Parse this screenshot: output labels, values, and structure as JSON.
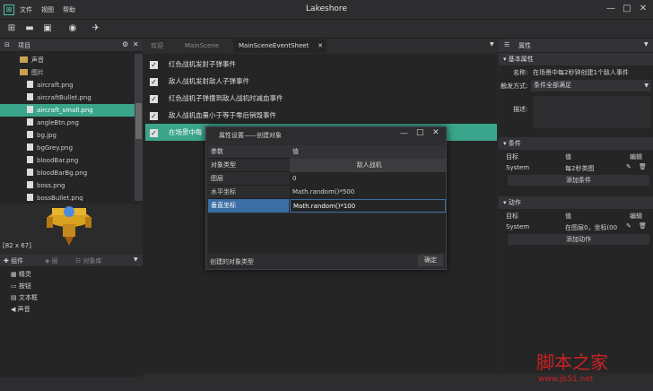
{
  "app": {
    "title": "Lakeshore",
    "menu": [
      "文件",
      "视图",
      "帮助"
    ]
  },
  "left": {
    "project_label": "项目",
    "tree": [
      {
        "label": "声音",
        "type": "folder"
      },
      {
        "label": "图片",
        "type": "folder"
      },
      {
        "label": "aircraft.png",
        "type": "file"
      },
      {
        "label": "aircraftBullet.png",
        "type": "file"
      },
      {
        "label": "aircraft_small.png",
        "type": "file",
        "selected": true
      },
      {
        "label": "angleBtn.png",
        "type": "file"
      },
      {
        "label": "bg.jpg",
        "type": "file"
      },
      {
        "label": "bgGrey.png",
        "type": "file"
      },
      {
        "label": "bloodBar.png",
        "type": "file"
      },
      {
        "label": "bloodBarBg.png",
        "type": "file"
      },
      {
        "label": "boss.png",
        "type": "file"
      },
      {
        "label": "bossBullet.png",
        "type": "file"
      }
    ],
    "preview_size": "[82 x 67]",
    "comp_tabs": [
      "组件",
      "层",
      "对象库"
    ],
    "components": [
      "精灵",
      "按钮",
      "文本框",
      "声音"
    ]
  },
  "tabs": [
    "欢迎",
    "MainScene",
    "MainSceneEventSheet"
  ],
  "events": [
    "红色战机发射子弹事件",
    "敌人战机发射敌人子弹事件",
    "红色战机子弹撞到敌人战机时减血事件",
    "敌人战机血量小于等于零后销毁事件",
    "在场景中每"
  ],
  "dialog": {
    "title": "属性设置——创建对象",
    "col_param": "参数",
    "col_value": "值",
    "rows": [
      {
        "k": "对象类型",
        "v": "敌人战机"
      },
      {
        "k": "图层",
        "v": "0"
      },
      {
        "k": "水平坐标",
        "v": "Math.random()*500"
      },
      {
        "k": "垂直坐标",
        "v": "Math.random()*100"
      }
    ],
    "footer": "创建的对象类型",
    "ok": "确定"
  },
  "right": {
    "tab": "属性",
    "basic": "基本属性",
    "name_k": "名称:",
    "name_v": "在场景中每2秒钟创建1个敌人事件",
    "trigger_k": "触发方式:",
    "trigger_v": "条件全部满足",
    "desc_k": "描述:",
    "cond": "条件",
    "target": "目标",
    "value": "值",
    "edit": "编辑",
    "cond_target": "System",
    "cond_value": "每2秒类图",
    "add_cond": "添加条件",
    "action": "动作",
    "act_target": "System",
    "act_value": "在图层0，坐标(00",
    "add_action": "添加动作"
  },
  "watermark": {
    "cn": "脚本之家",
    "url": "www.jb51.net"
  }
}
